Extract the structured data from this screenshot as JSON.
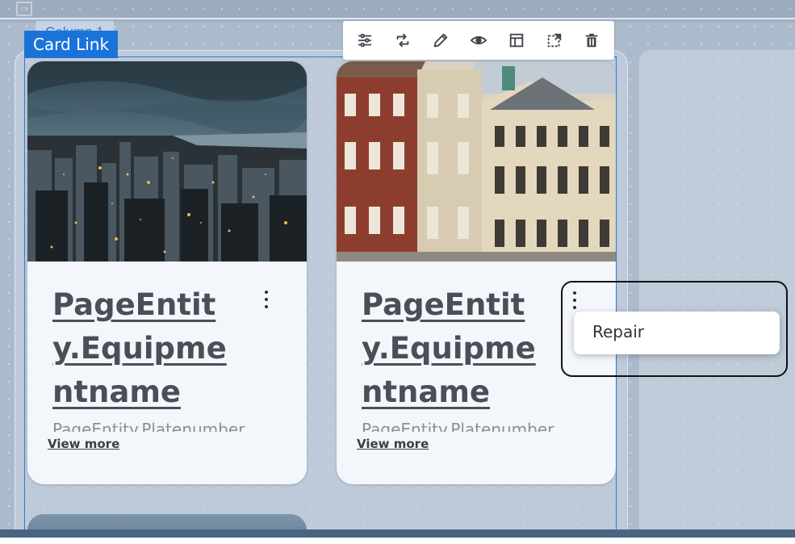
{
  "column": {
    "label": "Column 1"
  },
  "selection": {
    "label": "Card Link"
  },
  "toolbar": {
    "items": [
      "settings-icon",
      "swap-icon",
      "edit-icon",
      "preview-icon",
      "layout-icon",
      "detach-icon",
      "delete-icon"
    ]
  },
  "cards": [
    {
      "title": "PageEntity.Equipmentname",
      "subtitle": "PageEntity.Platenumber",
      "link": "View more",
      "image": "city-skyline-photo"
    },
    {
      "title": "PageEntity.Equipmentname",
      "subtitle": "PageEntity.Platenumber",
      "link": "View more",
      "image": "historic-building-photo"
    }
  ],
  "menu": {
    "items": [
      "Repair"
    ]
  },
  "colors": {
    "accent": "#1a73d9",
    "card_bg": "#f3f6fb",
    "canvas_bg": "#a3b1c3"
  }
}
